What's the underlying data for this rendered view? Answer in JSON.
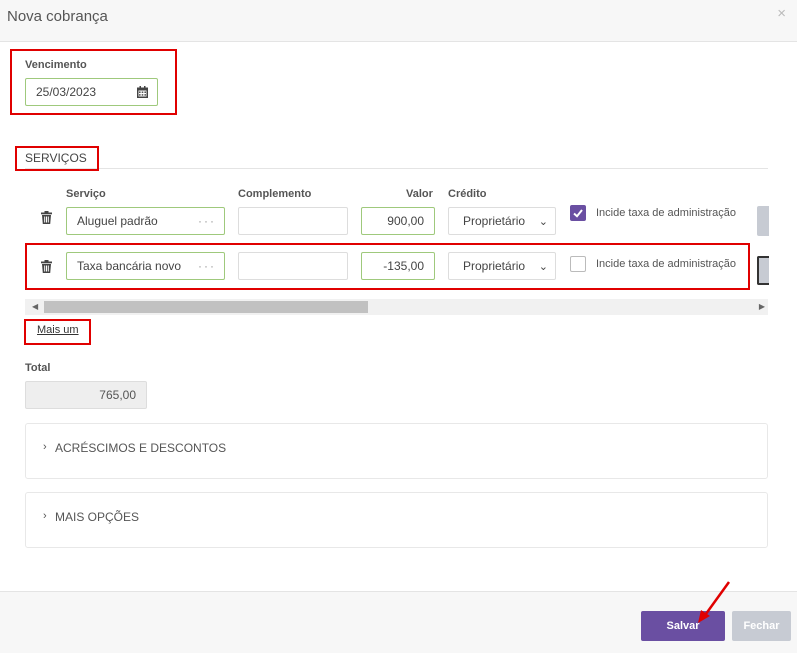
{
  "modal": {
    "title": "Nova cobrança",
    "close": "×"
  },
  "due": {
    "label": "Vencimento",
    "value": "25/03/2023"
  },
  "services": {
    "section_title": "SERVIÇOS",
    "headers": {
      "service": "Serviço",
      "complement": "Complemento",
      "value": "Valor",
      "credit": "Crédito"
    },
    "rows": [
      {
        "service": "Aluguel padrão",
        "complement": "",
        "value": "900,00",
        "credit": "Proprietário",
        "admin_fee_label": "Incide taxa de administração",
        "admin_fee_checked": true
      },
      {
        "service": "Taxa bancária novo",
        "complement": "",
        "value": "-135,00",
        "credit": "Proprietário",
        "admin_fee_label": "Incide taxa de administração",
        "admin_fee_checked": false
      }
    ],
    "add_more": "Mais um"
  },
  "total": {
    "label": "Total",
    "value": "765,00"
  },
  "sections": [
    {
      "label": "ACRÉSCIMOS E DESCONTOS"
    },
    {
      "label": "MAIS OPÇÕES"
    }
  ],
  "footer": {
    "save": "Salvar",
    "close": "Fechar"
  },
  "colors": {
    "accent": "#6a4fa2",
    "highlight": "#e00000",
    "valid_border": "#9fc97c"
  }
}
